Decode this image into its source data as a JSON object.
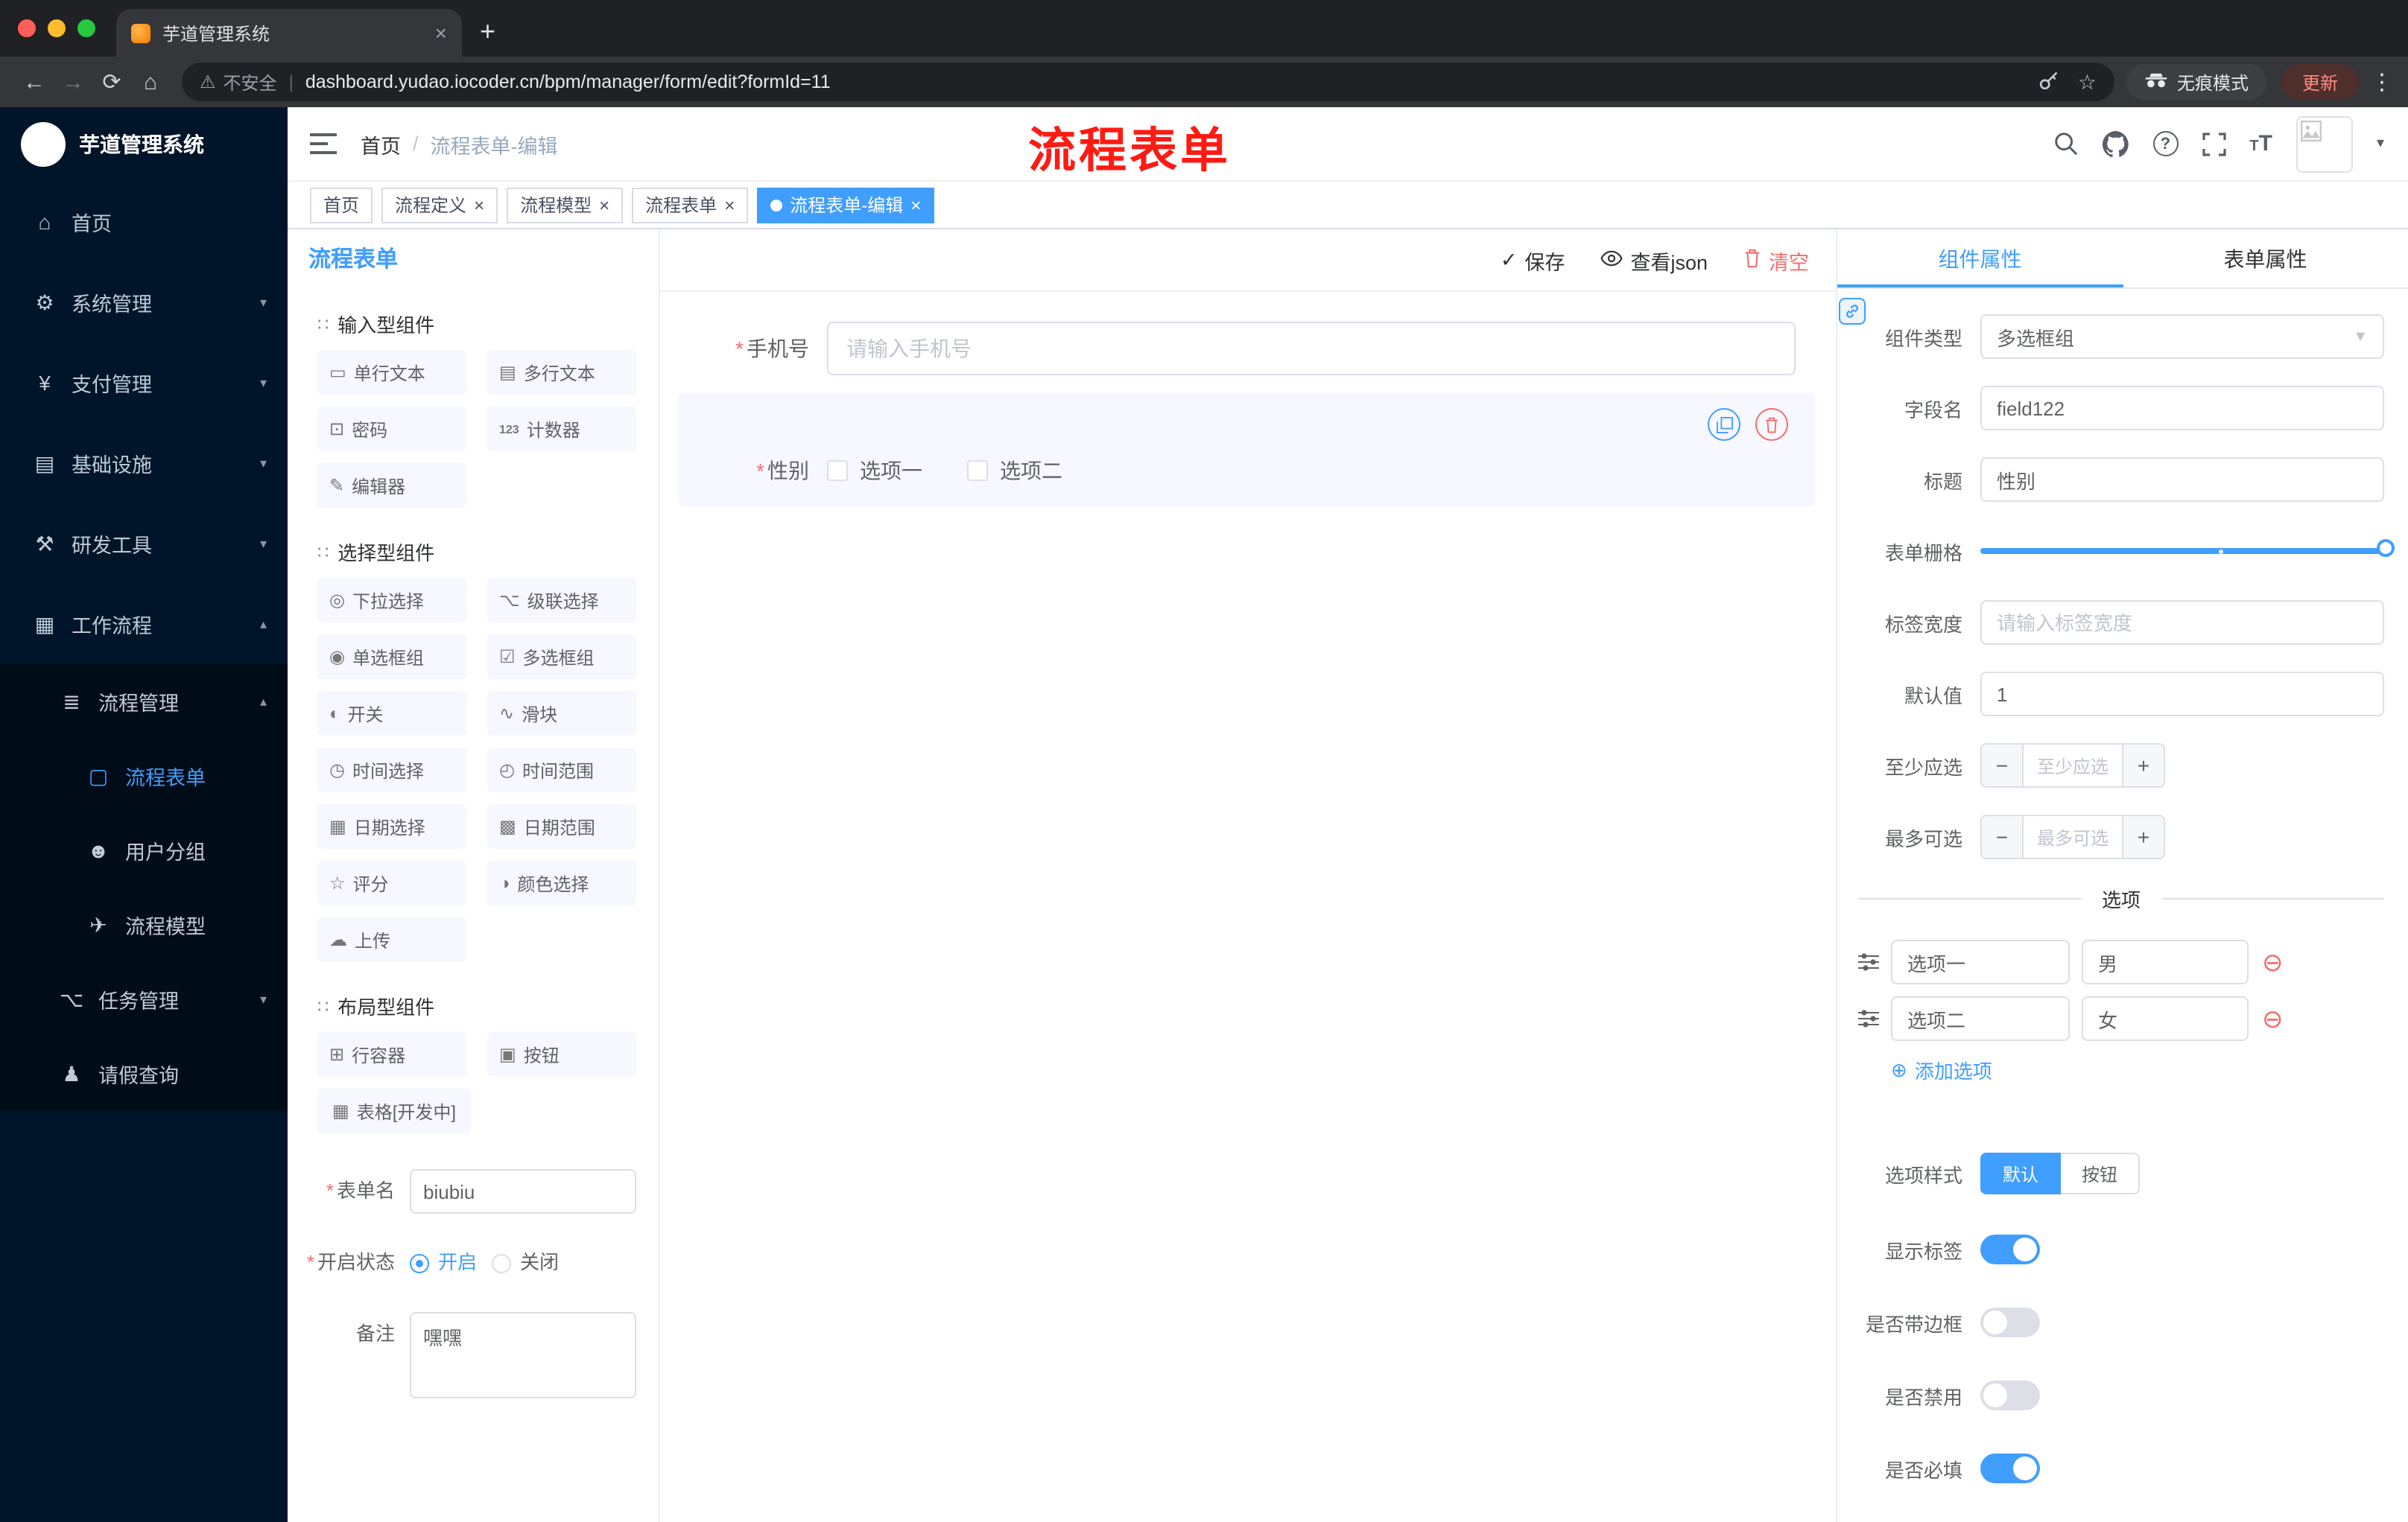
{
  "browser": {
    "tab_title": "芋道管理系统",
    "security_label": "不安全",
    "url": "dashboard.yudao.iocoder.cn/bpm/manager/form/edit?formId=11",
    "incognito_label": "无痕模式",
    "update_label": "更新"
  },
  "sidebar": {
    "logo_title": "芋道管理系统",
    "items": [
      {
        "label": "首页"
      },
      {
        "label": "系统管理"
      },
      {
        "label": "支付管理"
      },
      {
        "label": "基础设施"
      },
      {
        "label": "研发工具"
      },
      {
        "label": "工作流程"
      },
      {
        "label": "流程管理"
      },
      {
        "label": "流程表单"
      },
      {
        "label": "用户分组"
      },
      {
        "label": "流程模型"
      },
      {
        "label": "任务管理"
      },
      {
        "label": "请假查询"
      }
    ]
  },
  "header": {
    "breadcrumb_home": "首页",
    "breadcrumb_current": "流程表单-编辑",
    "annotation": "流程表单"
  },
  "tags_view": {
    "tags": [
      {
        "label": "首页"
      },
      {
        "label": "流程定义"
      },
      {
        "label": "流程模型"
      },
      {
        "label": "流程表单"
      },
      {
        "label": "流程表单-编辑"
      }
    ]
  },
  "designer": {
    "panel_title": "流程表单",
    "toolbar": {
      "save": "保存",
      "view_json": "查看json",
      "clear": "清空"
    },
    "palette": {
      "section1_title": "输入型组件",
      "section2_title": "选择型组件",
      "section3_title": "布局型组件",
      "input_items": [
        "单行文本",
        "多行文本",
        "密码",
        "计数器",
        "编辑器"
      ],
      "select_items": [
        "下拉选择",
        "级联选择",
        "单选框组",
        "多选框组",
        "开关",
        "滑块",
        "时间选择",
        "时间范围",
        "日期选择",
        "日期范围",
        "评分",
        "颜色选择",
        "上传"
      ],
      "layout_items": [
        "行容器",
        "按钮",
        "表格[开发中]"
      ]
    },
    "meta_form": {
      "name_label": "表单名",
      "name_value": "biubiu",
      "status_label": "开启状态",
      "status_on": "开启",
      "status_off": "关闭",
      "remark_label": "备注",
      "remark_value": "嘿嘿"
    },
    "canvas": {
      "phone_label": "手机号",
      "phone_placeholder": "请输入手机号",
      "gender_label": "性别",
      "gender_option1": "选项一",
      "gender_option2": "选项二"
    }
  },
  "properties": {
    "tab_component": "组件属性",
    "tab_form": "表单属性",
    "component_type_label": "组件类型",
    "component_type_value": "多选框组",
    "field_name_label": "字段名",
    "field_name_value": "field122",
    "title_label": "标题",
    "title_value": "性别",
    "grid_label": "表单栅格",
    "label_width_label": "标签宽度",
    "label_width_placeholder": "请输入标签宽度",
    "default_label": "默认值",
    "default_value": "1",
    "min_label": "至少应选",
    "min_placeholder": "至少应选",
    "max_label": "最多可选",
    "max_placeholder": "最多可选",
    "options_divider": "选项",
    "option1_label": "选项一",
    "option1_value": "男",
    "option2_label": "选项二",
    "option2_value": "女",
    "add_option": "添加选项",
    "style_label": "选项样式",
    "style_default": "默认",
    "style_button": "按钮",
    "toggle_show_label": "显示标签",
    "toggle_border": "是否带边框",
    "toggle_disabled": "是否禁用",
    "toggle_required": "是否必填"
  },
  "colors": {
    "primary": "#409EFF",
    "danger": "#F56C6C",
    "annotation_red": "#FE1B14",
    "sidebar_bg": "#001529",
    "submenu_bg": "#000C17"
  }
}
